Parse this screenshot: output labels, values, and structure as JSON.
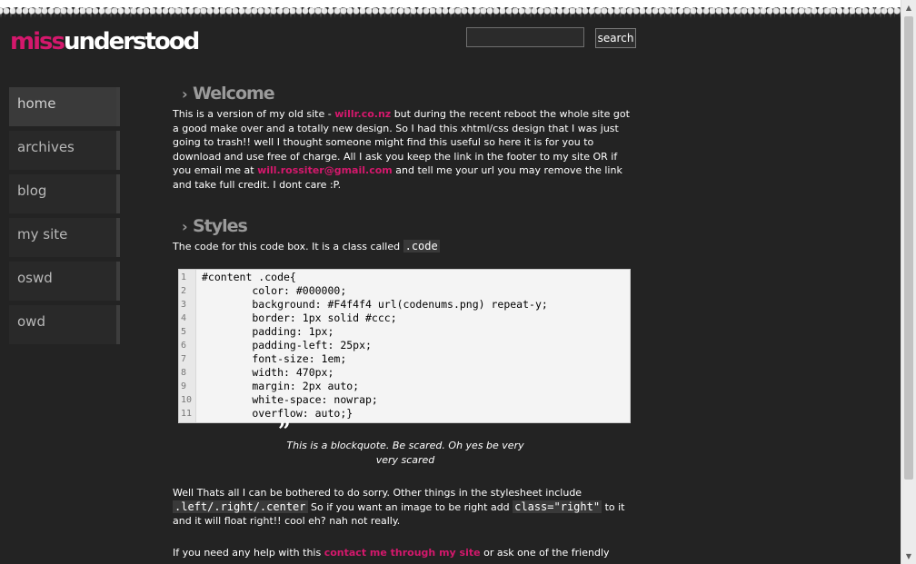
{
  "header": {
    "logo_part1": "miss",
    "logo_part2": "understood",
    "search_placeholder": "",
    "search_button": "search"
  },
  "nav": {
    "items": [
      {
        "label": "home",
        "active": true
      },
      {
        "label": "archives"
      },
      {
        "label": "blog"
      },
      {
        "label": "my site"
      },
      {
        "label": "oswd"
      },
      {
        "label": "owd"
      }
    ]
  },
  "welcome": {
    "heading": "Welcome",
    "p1_a": "This is a version of my old site - ",
    "p1_link1": "willr.co.nz",
    "p1_b": " but during the recent reboot the whole site got a good make over and a totally new design. So I had this xhtml/css design that I was just going to trash!! well I thought someone might find this useful so here it is for you to download and use free of charge. All I ask you keep the link in the footer to my site OR if you email me at ",
    "p1_link2": "will.rossiter@gmail.com",
    "p1_c": " and tell me your url you may remove the link and take full credit. I dont care :P."
  },
  "styles": {
    "heading": "Styles",
    "p_a": "The code for this code box. It is a class called ",
    "p_code": ".code"
  },
  "codebox": {
    "lines": [
      {
        "num": "1",
        "text": "#content .code{"
      },
      {
        "num": "2",
        "text": "        color: #000000;"
      },
      {
        "num": "3",
        "text": "        background: #F4f4f4 url(codenums.png) repeat-y;"
      },
      {
        "num": "4",
        "text": "        border: 1px solid #ccc;"
      },
      {
        "num": "5",
        "text": "        padding: 1px;"
      },
      {
        "num": "6",
        "text": "        padding-left: 25px;"
      },
      {
        "num": "7",
        "text": "        font-size: 1em;"
      },
      {
        "num": "8",
        "text": "        width: 470px;"
      },
      {
        "num": "9",
        "text": "        margin: 2px auto;"
      },
      {
        "num": "10",
        "text": "        white-space: nowrap;"
      },
      {
        "num": "11",
        "text": "        overflow: auto;}"
      }
    ]
  },
  "blockquote": {
    "mark": "”",
    "text": "This is a blockquote. Be scared. Oh yes be very very scared"
  },
  "after": {
    "p2_a": "Well Thats all I can be bothered to do sorry. Other things in the stylesheet include ",
    "p2_code1": ".left/.right/.center",
    "p2_b": " So if you want an image to be right add ",
    "p2_code2": "class=\"right\"",
    "p2_c": " to it and it will float right!! cool eh? nah not really.",
    "p3_a": "If you need any help with this ",
    "p3_link": "contact me through my site",
    "p3_b": " or ask one of the friendly"
  }
}
